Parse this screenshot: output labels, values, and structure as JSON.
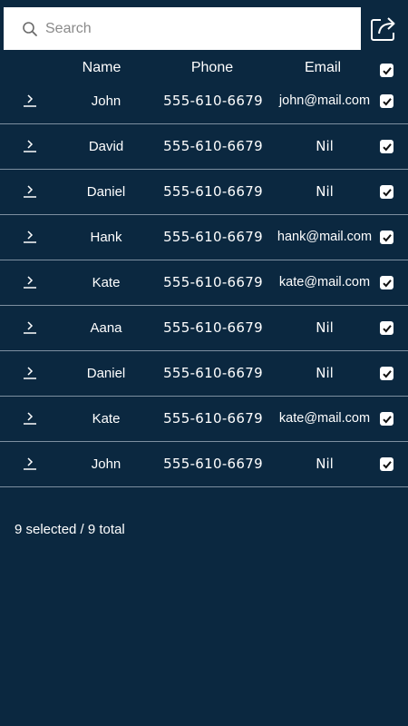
{
  "search": {
    "placeholder": "Search",
    "value": ""
  },
  "icons": {
    "search": "search-icon",
    "share": "share-icon",
    "row_expand": "chevron-right-icon",
    "checkbox": "checkbox-checked-icon"
  },
  "colors": {
    "background": "#0b2840",
    "divider": "#7d8fa0",
    "search_bg": "#ffffff"
  },
  "table": {
    "columns": [
      "Name",
      "Phone",
      "Email"
    ],
    "select_all_checked": true,
    "rows": [
      {
        "name": "John",
        "phone": "555-610-6679",
        "email": "john@mail.com",
        "checked": true
      },
      {
        "name": "David",
        "phone": "555-610-6679",
        "email": "Nil",
        "checked": true
      },
      {
        "name": "Daniel",
        "phone": "555-610-6679",
        "email": "Nil",
        "checked": true
      },
      {
        "name": "Hank",
        "phone": "555-610-6679",
        "email": "hank@mail.com",
        "checked": true
      },
      {
        "name": "Kate",
        "phone": "555-610-6679",
        "email": "kate@mail.com",
        "checked": true
      },
      {
        "name": "Aana",
        "phone": "555-610-6679",
        "email": "Nil",
        "checked": true
      },
      {
        "name": "Daniel",
        "phone": "555-610-6679",
        "email": "Nil",
        "checked": true
      },
      {
        "name": "Kate",
        "phone": "555-610-6679",
        "email": "kate@mail.com",
        "checked": true
      },
      {
        "name": "John",
        "phone": "555-610-6679",
        "email": "Nil",
        "checked": true
      }
    ]
  },
  "footer": {
    "status": "9 selected / 9 total"
  }
}
